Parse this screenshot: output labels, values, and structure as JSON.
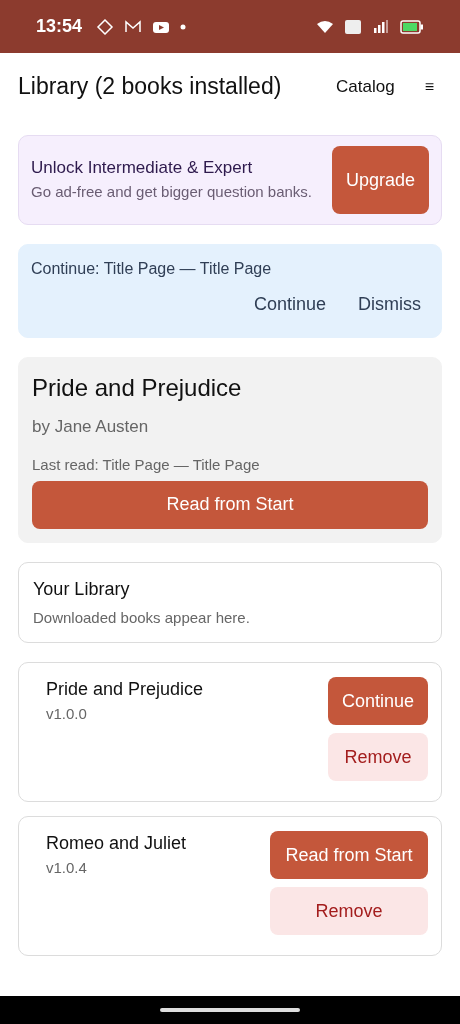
{
  "status_bar": {
    "time": "13:54"
  },
  "header": {
    "title": "Library (2 books installed)",
    "nav_link": "Catalog",
    "menu": "≡"
  },
  "promo": {
    "title": "Unlock Intermediate & Expert",
    "text": "Go ad-free and get bigger question banks.",
    "button": "Upgrade"
  },
  "resume_banner": {
    "text": "Continue: Title Page — Title Page",
    "actions": [
      "Continue",
      "Dismiss"
    ]
  },
  "current_book": {
    "title": "Pride and Prejudice",
    "author": "by Jane Austen",
    "last_read": "Last read: Title Page — Title Page",
    "button": "Read from Start"
  },
  "library_info": {
    "title": "Your Library",
    "text": "Downloaded books appear here."
  },
  "books": [
    {
      "title": "Pride and Prejudice",
      "version": "v1.0.0",
      "buttons": [
        {
          "label": "Continue",
          "kind": "primary"
        },
        {
          "label": "Remove",
          "kind": "danger"
        }
      ]
    },
    {
      "title": "Romeo and Juliet",
      "version": "v1.0.4",
      "buttons": [
        {
          "label": "Read from Start",
          "kind": "primary"
        },
        {
          "label": "Remove",
          "kind": "danger"
        }
      ]
    }
  ]
}
